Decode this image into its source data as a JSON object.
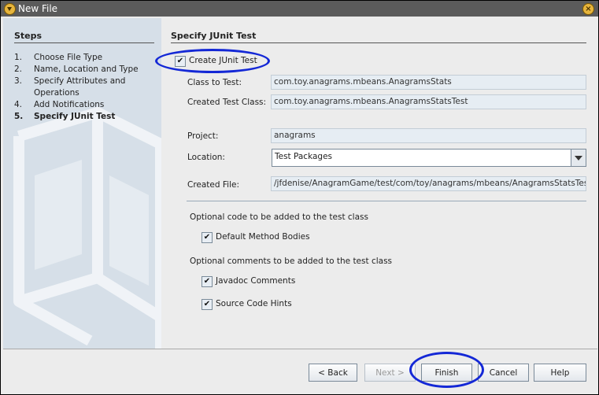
{
  "window": {
    "title": "New File"
  },
  "steps": {
    "title": "Steps",
    "items": [
      {
        "num": "1.",
        "label": "Choose File Type"
      },
      {
        "num": "2.",
        "label": "Name, Location and Type"
      },
      {
        "num": "3.",
        "label": "Specify Attributes and Operations"
      },
      {
        "num": "4.",
        "label": "Add Notifications"
      },
      {
        "num": "5.",
        "label": "Specify JUnit Test",
        "current": true
      }
    ]
  },
  "panel": {
    "title": "Specify JUnit Test",
    "create_junit_test": {
      "label": "Create JUnit Test",
      "checked": true
    },
    "class_to_test": {
      "label": "Class to Test:",
      "value": "com.toy.anagrams.mbeans.AnagramsStats"
    },
    "created_test_class": {
      "label": "Created Test Class:",
      "value": "com.toy.anagrams.mbeans.AnagramsStatsTest"
    },
    "project": {
      "label": "Project:",
      "value": "anagrams"
    },
    "location": {
      "label": "Location:",
      "value": "Test Packages"
    },
    "created_file": {
      "label": "Created File:",
      "value": "/jfdenise/AnagramGame/test/com/toy/anagrams/mbeans/AnagramsStatsTest.java"
    },
    "optional_code_label": "Optional code to be added to the test class",
    "default_method_bodies": {
      "label": "Default Method Bodies",
      "checked": true
    },
    "optional_comments_label": "Optional comments to be added to the test class",
    "javadoc_comments": {
      "label": "Javadoc Comments",
      "checked": true
    },
    "source_code_hints": {
      "label": "Source Code Hints",
      "checked": true
    }
  },
  "buttons": {
    "back": "< Back",
    "next": "Next >",
    "finish": "Finish",
    "cancel": "Cancel",
    "help": "Help"
  },
  "colors": {
    "highlight_ellipse": "#1428d6",
    "sidebar_bg": "#d6dfe8"
  },
  "icons": {
    "title_icon": "app-menu-icon",
    "close_icon": "close-icon",
    "combo_arrow": "chevron-down-icon"
  }
}
